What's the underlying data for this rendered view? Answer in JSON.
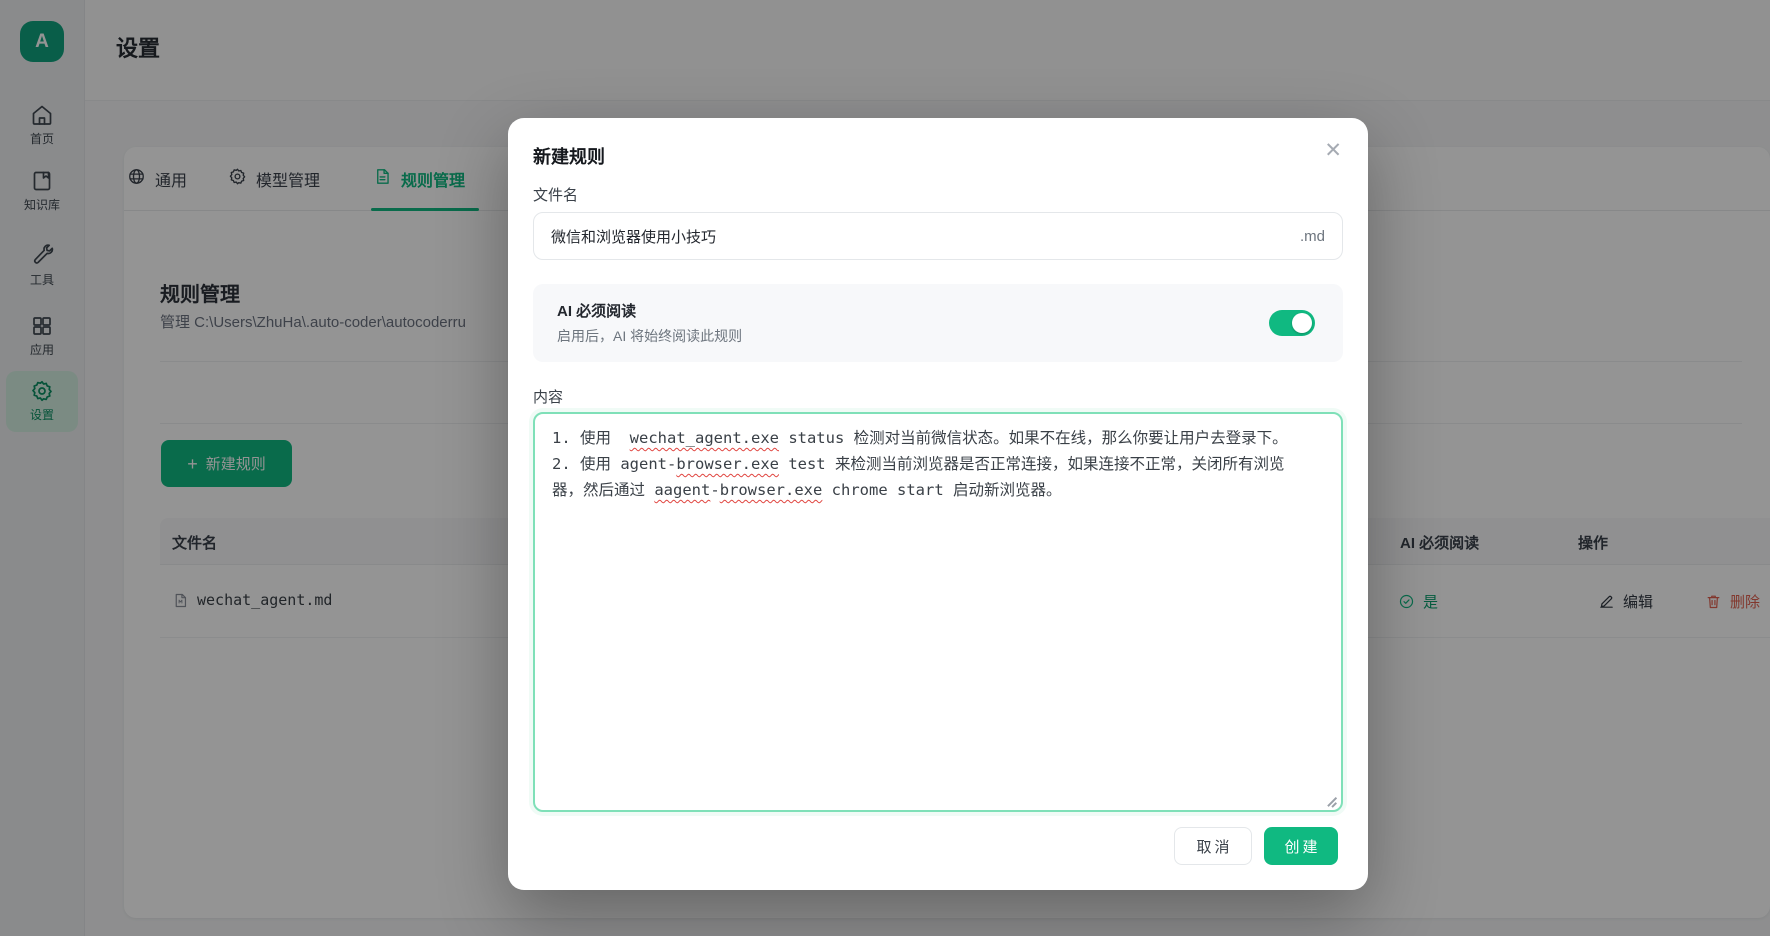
{
  "app": {
    "page_title": "设置",
    "avatar_letter": "A"
  },
  "sidebar": {
    "items": [
      {
        "icon": "home-icon",
        "label": "首页",
        "active": false
      },
      {
        "icon": "knowledge-base-icon",
        "label": "知识库",
        "active": false
      },
      {
        "icon": "tools-icon",
        "label": "工具",
        "active": false
      },
      {
        "icon": "apps-icon",
        "label": "应用",
        "active": false
      },
      {
        "icon": "settings-icon",
        "label": "设置",
        "active": true
      }
    ]
  },
  "tabs": [
    {
      "icon": "globe-icon",
      "label": "通用",
      "active": false
    },
    {
      "icon": "gear-icon",
      "label": "模型管理",
      "active": false
    },
    {
      "icon": "document-icon",
      "label": "规则管理",
      "active": true
    }
  ],
  "rules_panel": {
    "heading": "规则管理",
    "description": "管理 C:\\Users\\ZhuHa\\.auto-coder\\autocoderru",
    "new_rule_button": "新建规则",
    "plus": "+"
  },
  "table": {
    "headers": [
      "文件名",
      "AI 必须阅读",
      "操作"
    ],
    "rows": [
      {
        "filename": "wechat_agent.md",
        "ai_required": "是",
        "edit": "编辑",
        "delete": "删除"
      }
    ]
  },
  "modal": {
    "title": "新建规则",
    "close": "✕",
    "filename_label": "文件名",
    "filename_value": "微信和浏览器使用小技巧",
    "filename_suffix": ".md",
    "toggle": {
      "title": "AI 必须阅读",
      "subtitle": "启用后，AI 将始终阅读此规则",
      "state": "on"
    },
    "content_label": "内容",
    "content": {
      "full_text": "1. 使用  wechat_agent.exe status 检测对当前微信状态。如果不在线，那么你要让用户去登录下。\n2. 使用 agent-browser.exe test 来检测当前浏览器是否正常连接，如果连接不正常，关闭所有浏览器，然后通过 aagent-browser.exe chrome start 启动新浏览器。",
      "lines": [
        {
          "segments": [
            {
              "text": "1. 使用  "
            },
            {
              "text": "wechat_agent.exe",
              "squiggle": true
            },
            {
              "text": " status 检测对当前微信状态。如果不在线，那么你要让用户去登录下。"
            }
          ]
        },
        {
          "segments": [
            {
              "text": "2. 使用 agent-"
            },
            {
              "text": "browser.exe",
              "squiggle": true
            },
            {
              "text": " test 来检测当前浏览器是否正常连接，如果连接不正常，关闭所有浏览"
            }
          ]
        },
        {
          "segments": [
            {
              "text": "器，然后通过 "
            },
            {
              "text": "aagent",
              "squiggle": true
            },
            {
              "text": "-"
            },
            {
              "text": "browser.exe",
              "squiggle": true
            },
            {
              "text": " chrome start 启动新浏览器。"
            }
          ]
        }
      ]
    },
    "cancel_button": "取消",
    "create_button": "创建"
  },
  "colors": {
    "brand_green": "#10b981",
    "avatar_green": "#10a37f",
    "active_item_bg": "#d5efe2",
    "active_text_green": "#0a8f62",
    "delete_red": "#e0604f",
    "squiggle_red": "#e0443f",
    "textarea_focus_border": "#7fe0b8",
    "overlay": "rgba(0,0,0,0.42)"
  }
}
